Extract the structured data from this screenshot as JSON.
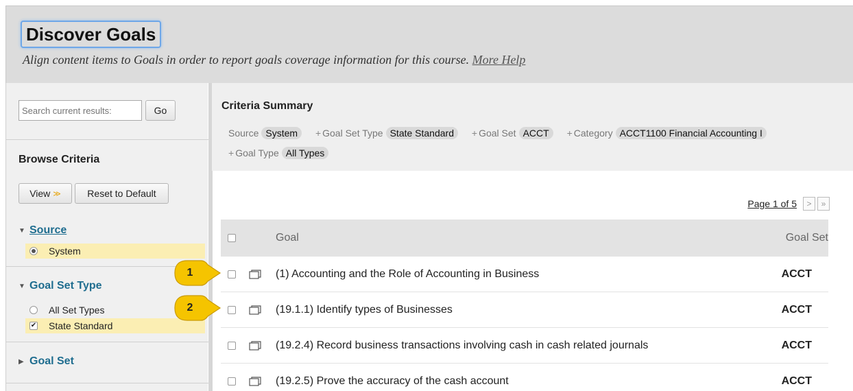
{
  "header": {
    "title": "Discover Goals",
    "subtitle": "Align content items to Goals in order to report goals coverage information for this course.",
    "help_link": "More Help"
  },
  "sidebar": {
    "search_placeholder": "Search current results:",
    "go_label": "Go",
    "browse_title": "Browse Criteria",
    "view_label": "View",
    "reset_label": "Reset to Default",
    "criteria": [
      {
        "label": "Source",
        "expanded": true,
        "options": [
          {
            "label": "System",
            "type": "radio",
            "selected": true
          }
        ]
      },
      {
        "label": "Goal Set Type",
        "expanded": true,
        "options": [
          {
            "label": "All Set Types",
            "type": "radio",
            "selected": false
          },
          {
            "label": "State Standard",
            "type": "checkbox",
            "selected": true
          }
        ]
      },
      {
        "label": "Goal Set",
        "expanded": false,
        "options": []
      }
    ]
  },
  "summary": {
    "title": "Criteria Summary",
    "items": [
      {
        "label": "Source",
        "value": "System",
        "plus": false
      },
      {
        "label": "Goal Set Type",
        "value": "State Standard",
        "plus": true
      },
      {
        "label": "Goal Set",
        "value": "ACCT",
        "plus": true
      },
      {
        "label": "Category",
        "value": "ACCT1100 Financial Accounting I",
        "plus": true
      },
      {
        "label": "Goal Type",
        "value": "All Types",
        "plus": true
      }
    ]
  },
  "pager": {
    "text": "Page 1 of 5",
    "next": ">",
    "last": "»"
  },
  "table": {
    "columns": {
      "goal": "Goal",
      "goal_set": "Goal Set"
    },
    "rows": [
      {
        "goal": "(1) Accounting and the Role of Accounting in Business",
        "goal_set": "ACCT"
      },
      {
        "goal": "(19.1.1) Identify types of Businesses",
        "goal_set": "ACCT"
      },
      {
        "goal": "(19.2.4) Record business transactions involving cash in cash related journals",
        "goal_set": "ACCT"
      },
      {
        "goal": "(19.2.5) Prove the accuracy of the cash account",
        "goal_set": "ACCT"
      }
    ]
  },
  "callouts": [
    "1",
    "2"
  ],
  "colors": {
    "accent": "#1f6d8f",
    "highlight": "#fbeeb3",
    "callout": "#f5c400"
  }
}
